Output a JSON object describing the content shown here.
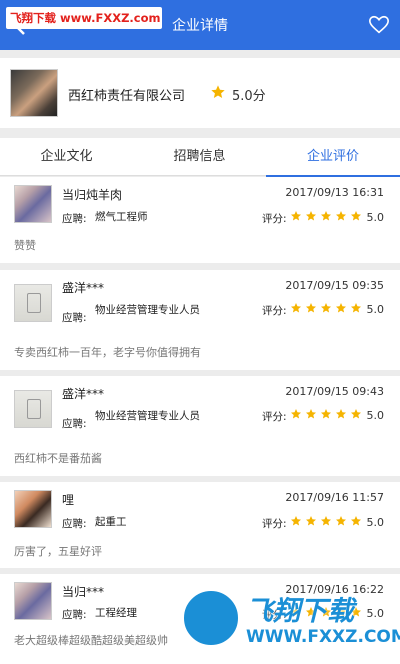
{
  "header": {
    "title": "企业详情",
    "watermark": "飞翔下载 www.FXXZ.com",
    "heart_icon": "heart-outline-icon",
    "back_icon": "back-arrow-icon",
    "colors": {
      "header_bg": "#2f6fe0",
      "star": "#f5b400",
      "watermark_red": "#e3211c",
      "watermark_blue": "#1b8fd6"
    }
  },
  "company": {
    "name": "西红柿责任有限公司",
    "score": "5.0分"
  },
  "tabs": [
    {
      "label": "企业文化",
      "active": false
    },
    {
      "label": "招聘信息",
      "active": false
    },
    {
      "label": "企业评价",
      "active": true
    }
  ],
  "reviews": [
    {
      "nick": "当归炖羊肉",
      "time": "2017/09/13 16:31",
      "job_label": "应聘:",
      "job": "燃气工程师",
      "rate_label": "评分:",
      "stars": 5,
      "rating": "5.0",
      "comment": "赞赞"
    },
    {
      "nick": "盛洋***",
      "time": "2017/09/15 09:35",
      "job_label": "应聘:",
      "job": "物业经营管理专业人员",
      "rate_label": "评分:",
      "stars": 5,
      "rating": "5.0",
      "comment": "专卖西红柿一百年，老字号你值得拥有"
    },
    {
      "nick": "盛洋***",
      "time": "2017/09/15 09:43",
      "job_label": "应聘:",
      "job": "物业经营管理专业人员",
      "rate_label": "评分:",
      "stars": 5,
      "rating": "5.0",
      "comment": "西红柿不是番茄酱"
    },
    {
      "nick": "哩",
      "time": "2017/09/16 11:57",
      "job_label": "应聘:",
      "job": "起重工",
      "rate_label": "评分:",
      "stars": 5,
      "rating": "5.0",
      "comment": "厉害了，五星好评"
    },
    {
      "nick": "当归***",
      "time": "2017/09/16 16:22",
      "job_label": "应聘:",
      "job": "工程经理",
      "rate_label": "评分:",
      "stars": 5,
      "rating": "5.0",
      "comment": "老大超级棒超级酷超级美超级帅"
    }
  ],
  "watermark_bottom": {
    "big": "飞翔下载",
    "small": "WWW.FXXZ.COM"
  }
}
